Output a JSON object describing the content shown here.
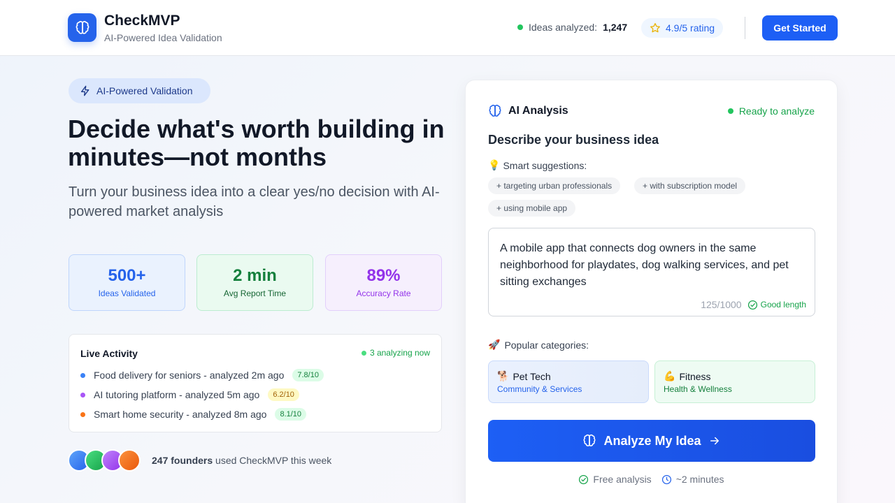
{
  "header": {
    "brand_name": "CheckMVP",
    "brand_tagline": "AI-Powered Idea Validation",
    "ideas_label": "Ideas analyzed:",
    "ideas_count": "1,247",
    "rating": "4.9/5 rating",
    "cta": "Get Started"
  },
  "hero": {
    "badge": "AI-Powered Validation",
    "headline": "Decide what's worth building in minutes—not months",
    "subheadline": "Turn your business idea into a clear yes/no decision with AI-powered market analysis"
  },
  "stats": [
    {
      "value": "500+",
      "label": "Ideas Validated"
    },
    {
      "value": "2 min",
      "label": "Avg Report Time"
    },
    {
      "value": "89%",
      "label": "Accuracy Rate"
    }
  ],
  "activity": {
    "title": "Live Activity",
    "analyzing_now": "3 analyzing now",
    "items": [
      {
        "text": "Food delivery for seniors - analyzed 2m ago",
        "score": "7.8/10",
        "dot_color": "#3b82f6"
      },
      {
        "text": "AI tutoring platform - analyzed 5m ago",
        "score": "6.2/10",
        "dot_color": "#a855f7"
      },
      {
        "text": "Smart home security - analyzed 8m ago",
        "score": "8.1/10",
        "dot_color": "#f97316"
      }
    ]
  },
  "social_proof": {
    "founders_count": "247 founders",
    "founders_text": "used CheckMVP this week",
    "avatar_colors": [
      "#3b82f6",
      "#22c55e",
      "#a855f7",
      "#f97316"
    ]
  },
  "panel": {
    "title": "AI Analysis",
    "status": "Ready to analyze",
    "heading": "Describe your business idea",
    "suggestions_title": "Smart suggestions:",
    "suggestions": [
      "+ targeting urban professionals",
      "+ with subscription model",
      "+ using mobile app"
    ],
    "idea_text": "A mobile app that connects dog owners in the same neighborhood for playdates, dog walking services, and pet sitting exchanges",
    "char_count": "125/1000",
    "length_status": "Good length",
    "categories_title": "Popular categories:",
    "categories": [
      {
        "emoji": "🐕",
        "name": "Pet Tech",
        "sub": "Community & Services"
      },
      {
        "emoji": "💪",
        "name": "Fitness",
        "sub": "Health & Wellness"
      }
    ],
    "analyze_button": "Analyze My Idea",
    "footer_free": "Free analysis",
    "footer_time": "~2 minutes"
  },
  "colors": {
    "primary": "#1d5ff5",
    "success": "#16a34a"
  },
  "icons": {
    "logo": "brain-icon",
    "rating": "star-icon",
    "badge": "lightning-icon",
    "suggestions": "lightbulb-icon",
    "categories": "rocket-icon",
    "good_length": "check-circle-icon",
    "button_arrow": "arrow-right-icon",
    "time": "clock-icon"
  }
}
